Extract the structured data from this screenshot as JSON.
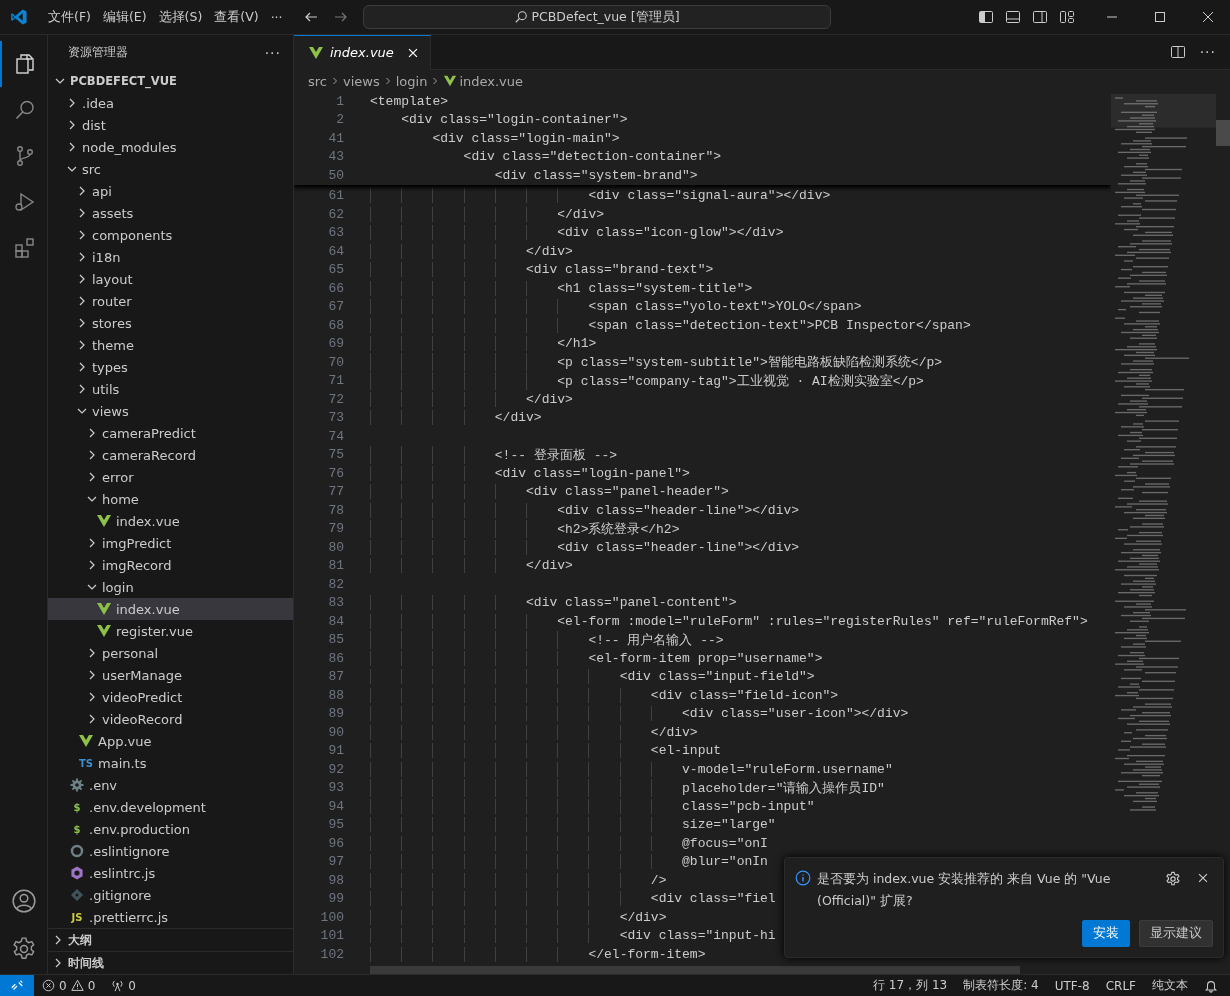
{
  "title_bar": {
    "menus": [
      "文件(F)",
      "编辑(E)",
      "选择(S)",
      "查看(V)"
    ],
    "more": "···",
    "search": "PCBDefect_vue [管理员]"
  },
  "activity_bar": {
    "items": [
      {
        "kind": "files",
        "selected": true
      },
      {
        "kind": "search",
        "selected": false
      },
      {
        "kind": "source-control",
        "selected": false
      },
      {
        "kind": "debug",
        "selected": false
      },
      {
        "kind": "extensions",
        "selected": false
      }
    ]
  },
  "sidebar": {
    "title": "资源管理器",
    "more": "···",
    "root": {
      "label": "PCBDEFECT_VUE",
      "expanded": true
    },
    "tree": [
      {
        "label": ".idea",
        "kind": "folder",
        "expanded": false,
        "selected": false
      },
      {
        "label": "dist",
        "kind": "folder",
        "expanded": false,
        "selected": false
      },
      {
        "label": "node_modules",
        "kind": "folder",
        "expanded": false,
        "selected": false
      },
      {
        "label": "src",
        "kind": "folder",
        "expanded": true,
        "selected": false,
        "children": [
          {
            "label": "api",
            "kind": "folder",
            "expanded": false,
            "selected": false
          },
          {
            "label": "assets",
            "kind": "folder",
            "expanded": false,
            "selected": false
          },
          {
            "label": "components",
            "kind": "folder",
            "expanded": false,
            "selected": false
          },
          {
            "label": "i18n",
            "kind": "folder",
            "expanded": false,
            "selected": false
          },
          {
            "label": "layout",
            "kind": "folder",
            "expanded": false,
            "selected": false
          },
          {
            "label": "router",
            "kind": "folder",
            "expanded": false,
            "selected": false
          },
          {
            "label": "stores",
            "kind": "folder",
            "expanded": false,
            "selected": false
          },
          {
            "label": "theme",
            "kind": "folder",
            "expanded": false,
            "selected": false
          },
          {
            "label": "types",
            "kind": "folder",
            "expanded": false,
            "selected": false
          },
          {
            "label": "utils",
            "kind": "folder",
            "expanded": false,
            "selected": false
          },
          {
            "label": "views",
            "kind": "folder",
            "expanded": true,
            "selected": false,
            "children": [
              {
                "label": "cameraPredict",
                "kind": "folder",
                "expanded": false,
                "selected": false
              },
              {
                "label": "cameraRecord",
                "kind": "folder",
                "expanded": false,
                "selected": false
              },
              {
                "label": "error",
                "kind": "folder",
                "expanded": false,
                "selected": false
              },
              {
                "label": "home",
                "kind": "folder",
                "expanded": true,
                "selected": false,
                "children": [
                  {
                    "label": "index.vue",
                    "kind": "vue",
                    "selected": false
                  }
                ]
              },
              {
                "label": "imgPredict",
                "kind": "folder",
                "expanded": false,
                "selected": false
              },
              {
                "label": "imgRecord",
                "kind": "folder",
                "expanded": false,
                "selected": false
              },
              {
                "label": "login",
                "kind": "folder",
                "expanded": true,
                "selected": false,
                "children": [
                  {
                    "label": "index.vue",
                    "kind": "vue",
                    "selected": true
                  },
                  {
                    "label": "register.vue",
                    "kind": "vue",
                    "selected": false
                  }
                ]
              },
              {
                "label": "personal",
                "kind": "folder",
                "expanded": false,
                "selected": false
              },
              {
                "label": "userManage",
                "kind": "folder",
                "expanded": false,
                "selected": false
              },
              {
                "label": "videoPredict",
                "kind": "folder",
                "expanded": false,
                "selected": false
              },
              {
                "label": "videoRecord",
                "kind": "folder",
                "expanded": false,
                "selected": false
              }
            ]
          },
          {
            "label": "App.vue",
            "kind": "vue",
            "selected": false
          },
          {
            "label": "main.ts",
            "kind": "badge",
            "badge": "TS",
            "color": "#3c8fd0",
            "selected": false
          }
        ]
      },
      {
        "label": ".env",
        "kind": "gear",
        "selected": false
      },
      {
        "label": ".env.development",
        "kind": "badge",
        "badge": "$",
        "color": "#8dc149",
        "selected": false
      },
      {
        "label": ".env.production",
        "kind": "badge",
        "badge": "$",
        "color": "#8dc149",
        "selected": false
      },
      {
        "label": ".eslintignore",
        "kind": "ring",
        "selected": false
      },
      {
        "label": ".eslintrc.js",
        "kind": "eslint",
        "selected": false
      },
      {
        "label": ".gitignore",
        "kind": "git",
        "selected": false
      },
      {
        "label": ".prettierrc.js",
        "kind": "badge",
        "badge": "JS",
        "color": "#cbcb41",
        "selected": false
      }
    ],
    "sections": [
      {
        "label": "大纲",
        "expanded": false
      },
      {
        "label": "时间线",
        "expanded": false
      }
    ]
  },
  "editor": {
    "tabs": [
      {
        "label": "index.vue",
        "selected": true
      }
    ],
    "more": "···",
    "breadcrumb": [
      "src",
      "views",
      "login",
      "index.vue"
    ],
    "sticky_lines": [
      {
        "number": "1",
        "text": "<template>"
      },
      {
        "number": "2",
        "text": "    <div class=\"login-container\">"
      },
      {
        "number": "41",
        "text": "        <div class=\"login-main\">"
      },
      {
        "number": "43",
        "text": "            <div class=\"detection-container\">"
      },
      {
        "number": "50",
        "text": "                <div class=\"system-brand\">"
      }
    ],
    "lines": [
      {
        "number": "61",
        "text": "                            <div class=\"signal-aura\"></div>"
      },
      {
        "number": "62",
        "text": "                        </div>"
      },
      {
        "number": "63",
        "text": "                        <div class=\"icon-glow\"></div>"
      },
      {
        "number": "64",
        "text": "                    </div>"
      },
      {
        "number": "65",
        "text": "                    <div class=\"brand-text\">"
      },
      {
        "number": "66",
        "text": "                        <h1 class=\"system-title\">"
      },
      {
        "number": "67",
        "text": "                            <span class=\"yolo-text\">YOLO</span>"
      },
      {
        "number": "68",
        "text": "                            <span class=\"detection-text\">PCB Inspector</span>"
      },
      {
        "number": "69",
        "text": "                        </h1>"
      },
      {
        "number": "70",
        "text": "                        <p class=\"system-subtitle\">智能电路板缺陷检测系统</p>"
      },
      {
        "number": "71",
        "text": "                        <p class=\"company-tag\">工业视觉 · AI检测实验室</p>"
      },
      {
        "number": "72",
        "text": "                    </div>"
      },
      {
        "number": "73",
        "text": "                </div>"
      },
      {
        "number": "74"
      },
      {
        "number": "75",
        "text": "                <!-- 登录面板 -->"
      },
      {
        "number": "76",
        "text": "                <div class=\"login-panel\">"
      },
      {
        "number": "77",
        "text": "                    <div class=\"panel-header\">"
      },
      {
        "number": "78",
        "text": "                        <div class=\"header-line\"></div>"
      },
      {
        "number": "79",
        "text": "                        <h2>系统登录</h2>"
      },
      {
        "number": "80",
        "text": "                        <div class=\"header-line\"></div>"
      },
      {
        "number": "81",
        "text": "                    </div>"
      },
      {
        "number": "82"
      },
      {
        "number": "83",
        "text": "                    <div class=\"panel-content\">"
      },
      {
        "number": "84",
        "text": "                        <el-form :model=\"ruleForm\" :rules=\"registerRules\" ref=\"ruleFormRef\">"
      },
      {
        "number": "85",
        "text": "                            <!-- 用户名输入 -->"
      },
      {
        "number": "86",
        "text": "                            <el-form-item prop=\"username\">"
      },
      {
        "number": "87",
        "text": "                                <div class=\"input-field\">"
      },
      {
        "number": "88",
        "text": "                                    <div class=\"field-icon\">"
      },
      {
        "number": "89",
        "text": "                                        <div class=\"user-icon\"></div>"
      },
      {
        "number": "90",
        "text": "                                    </div>"
      },
      {
        "number": "91",
        "text": "                                    <el-input"
      },
      {
        "number": "92",
        "text": "                                        v-model=\"ruleForm.username\""
      },
      {
        "number": "93",
        "text": "                                        placeholder=\"请输入操作员ID\""
      },
      {
        "number": "94",
        "text": "                                        class=\"pcb-input\""
      },
      {
        "number": "95",
        "text": "                                        size=\"large\""
      },
      {
        "number": "96",
        "text": "                                        @focus=\"onI"
      },
      {
        "number": "97",
        "text": "                                        @blur=\"onIn"
      },
      {
        "number": "98",
        "text": "                                    />"
      },
      {
        "number": "99",
        "text": "                                    <div class=\"fiel"
      },
      {
        "number": "100",
        "text": "                                </div>"
      },
      {
        "number": "101",
        "text": "                                <div class=\"input-hi"
      },
      {
        "number": "102",
        "text": "                            </el-form-item>"
      }
    ]
  },
  "notification": {
    "message": "是否要为 index.vue 安装推荐的 来自 Vue 的 \"Vue (Official)\" 扩展?",
    "buttons": [
      {
        "label": "安装",
        "kind": "primary"
      },
      {
        "label": "显示建议",
        "kind": "secondary"
      }
    ]
  },
  "status_bar": {
    "errors": "0",
    "warnings": "0",
    "ports": "0",
    "items": [
      "行 17，列 13",
      "制表符长度: 4",
      "UTF-8",
      "CRLF",
      "纯文本"
    ]
  }
}
